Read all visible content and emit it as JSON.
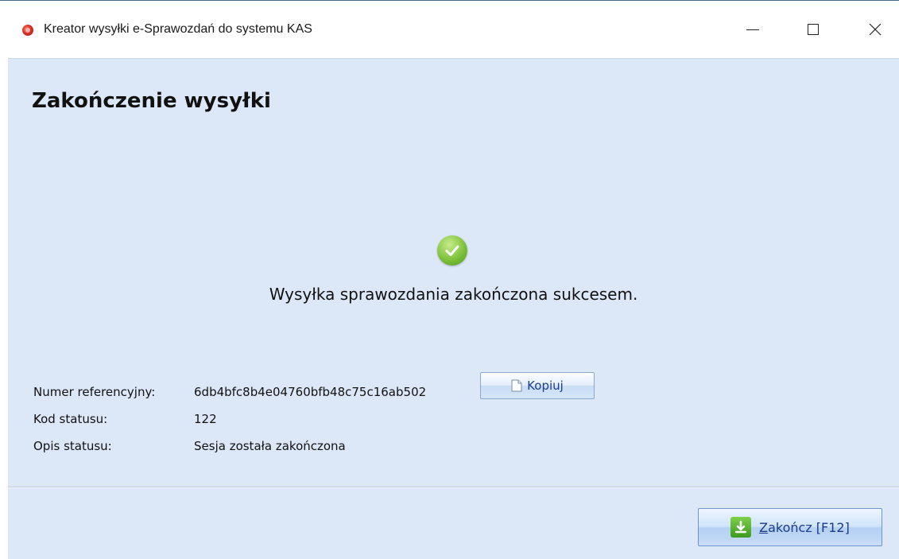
{
  "window": {
    "title": "Kreator wysyłki e-Sprawozdań do systemu KAS",
    "icon": "app-logo-icon",
    "controls": [
      "minimize-icon",
      "maximize-icon",
      "close-icon"
    ]
  },
  "main": {
    "heading": "Zakończenie wysyłki",
    "status_icon": "success-check-icon",
    "success_message": "Wysyłka sprawozdania zakończona sukcesem.",
    "details": {
      "reference_label": "Numer referencyjny:",
      "reference_value": "6db4bfc8b4e04760bfb48c75c16ab502",
      "status_code_label": "Kod statusu:",
      "status_code_value": "122",
      "status_desc_label": "Opis statusu:",
      "status_desc_value": "Sesja została zakończona"
    },
    "copy_button": {
      "label": "Kopiuj",
      "icon": "document-icon"
    }
  },
  "footer": {
    "finish_button": {
      "mnemonic": "Z",
      "label_rest": "akończ [F12]",
      "icon": "download-icon"
    }
  },
  "colors": {
    "panel_bg": "#dce8f8",
    "button_text": "#1a3c8a",
    "success_green": "#7ec23c"
  }
}
